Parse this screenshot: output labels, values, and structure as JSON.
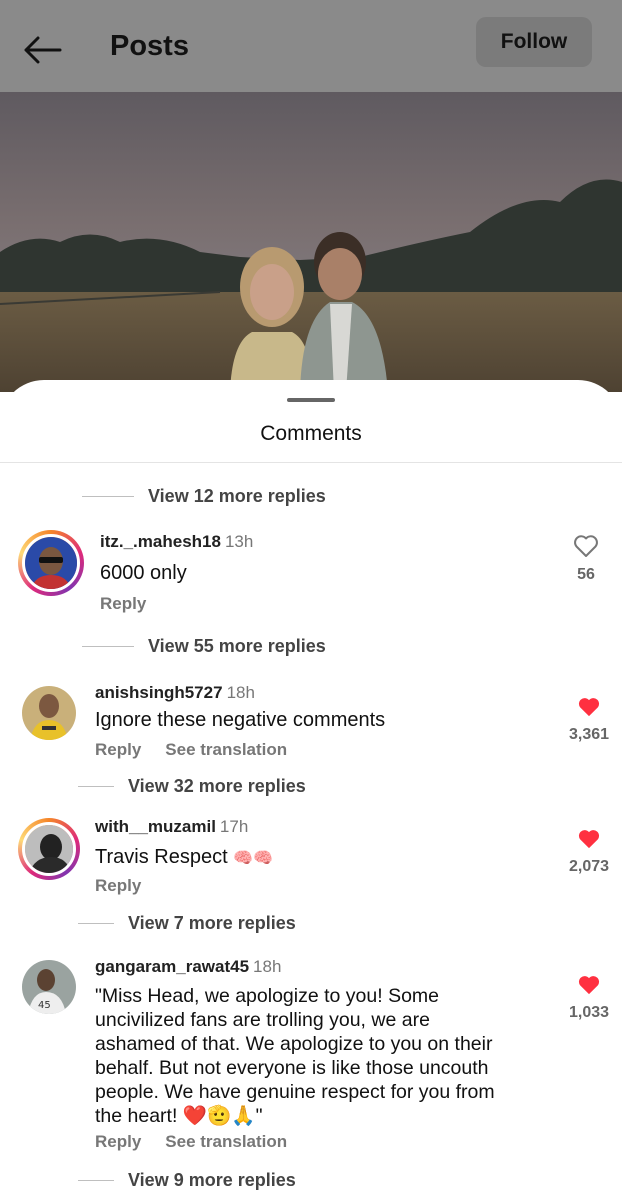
{
  "header": {
    "title": "Posts",
    "follow_label": "Follow"
  },
  "sheet": {
    "title": "Comments"
  },
  "comments": [
    {
      "view_replies_above": "View 12 more replies",
      "username": "itz._.mahesh18",
      "time": "13h",
      "text": "6000 only",
      "reply_label": "Reply",
      "likes": "56",
      "liked": false,
      "view_replies_below": "View 55 more replies"
    },
    {
      "username": "anishsingh5727",
      "time": "18h",
      "text": "Ignore these negative comments",
      "reply_label": "Reply",
      "translate_label": "See translation",
      "likes": "3,361",
      "liked": true,
      "view_replies_below": "View 32 more replies"
    },
    {
      "username": "with__muzamil",
      "time": "17h",
      "text": "Travis Respect",
      "emojis": "🧠🧠",
      "reply_label": "Reply",
      "likes": "2,073",
      "liked": true,
      "view_replies_below": "View 7 more replies"
    },
    {
      "username": "gangaram_rawat45",
      "time": "18h",
      "text_lines": [
        "\"Miss Head, we apologize to you! Some",
        "uncivilized fans are trolling you, we are",
        "ashamed of that. We apologize to you on their",
        "behalf. But not everyone is like those uncouth",
        "people. We have genuine respect for you from",
        "the heart! ❤️🫡🙏\""
      ],
      "reply_label": "Reply",
      "translate_label": "See translation",
      "likes": "1,033",
      "liked": true,
      "view_replies_below": "View 9 more replies"
    }
  ],
  "colors": {
    "like_red": "#ff3040",
    "header_dim": "#8a8a8a"
  }
}
